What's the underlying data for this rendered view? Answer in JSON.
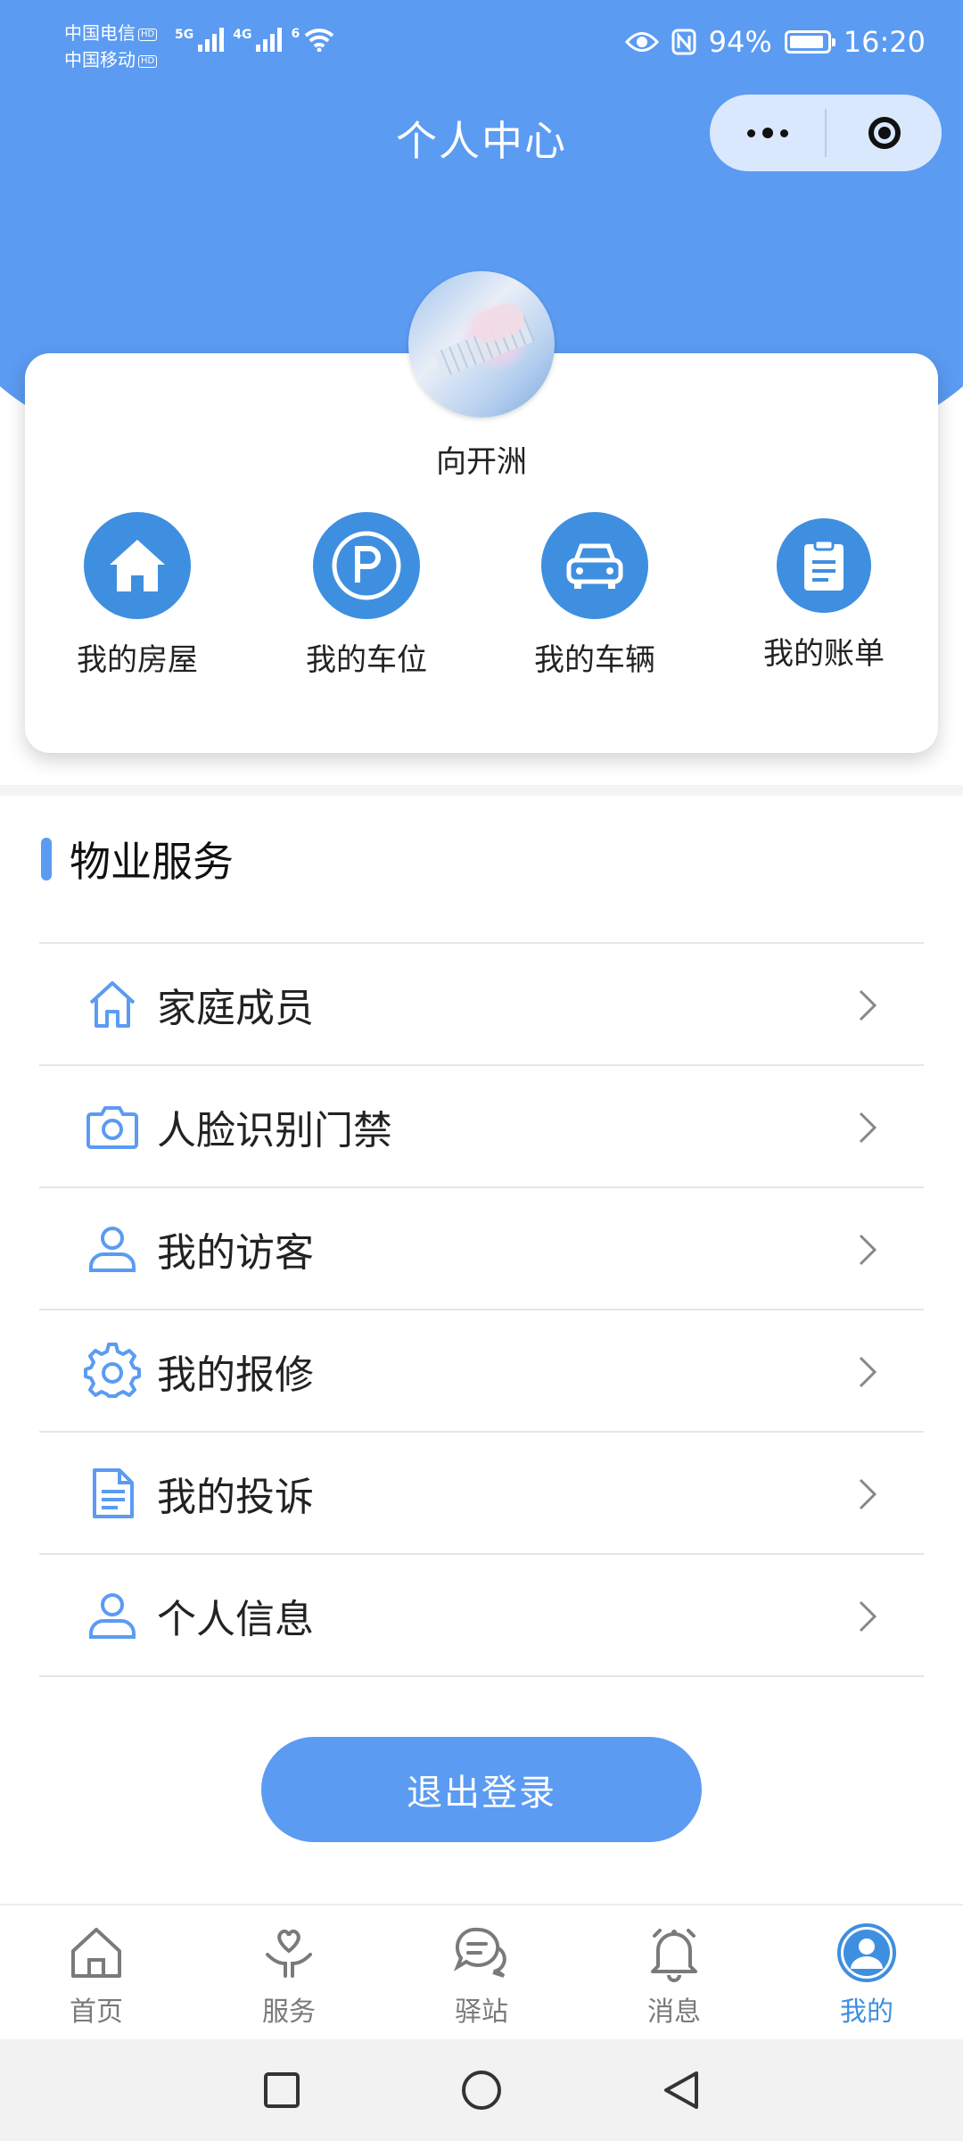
{
  "status_bar": {
    "carrier1": "中国电信",
    "carrier2": "中国移动",
    "hd": "HD",
    "net1": "5G",
    "net2": "4G",
    "wifi": "6",
    "battery": "94%",
    "battery_level": 0.94,
    "time": "16:20"
  },
  "header": {
    "title": "个人中心"
  },
  "profile": {
    "name": "向开洲",
    "quick_actions": [
      {
        "label": "我的房屋",
        "icon": "house-icon"
      },
      {
        "label": "我的车位",
        "icon": "parking-icon"
      },
      {
        "label": "我的车辆",
        "icon": "car-icon"
      },
      {
        "label": "我的账单",
        "icon": "bill-icon"
      }
    ]
  },
  "services": {
    "title": "物业服务",
    "items": [
      {
        "label": "家庭成员",
        "icon": "home-outline-icon"
      },
      {
        "label": "人脸识别门禁",
        "icon": "camera-icon"
      },
      {
        "label": "我的访客",
        "icon": "user-icon"
      },
      {
        "label": "我的报修",
        "icon": "gear-icon"
      },
      {
        "label": "我的投诉",
        "icon": "document-icon"
      },
      {
        "label": "个人信息",
        "icon": "user-icon"
      }
    ]
  },
  "logout_label": "退出登录",
  "tabs": [
    {
      "label": "首页",
      "icon": "home-tab-icon"
    },
    {
      "label": "服务",
      "icon": "service-tab-icon"
    },
    {
      "label": "驿站",
      "icon": "chat-tab-icon"
    },
    {
      "label": "消息",
      "icon": "bell-tab-icon"
    },
    {
      "label": "我的",
      "icon": "profile-tab-icon",
      "active": true
    }
  ],
  "colors": {
    "primary": "#5b9bf2",
    "icon_circle": "#3f8fe0",
    "active_tab": "#3f8fe0"
  }
}
